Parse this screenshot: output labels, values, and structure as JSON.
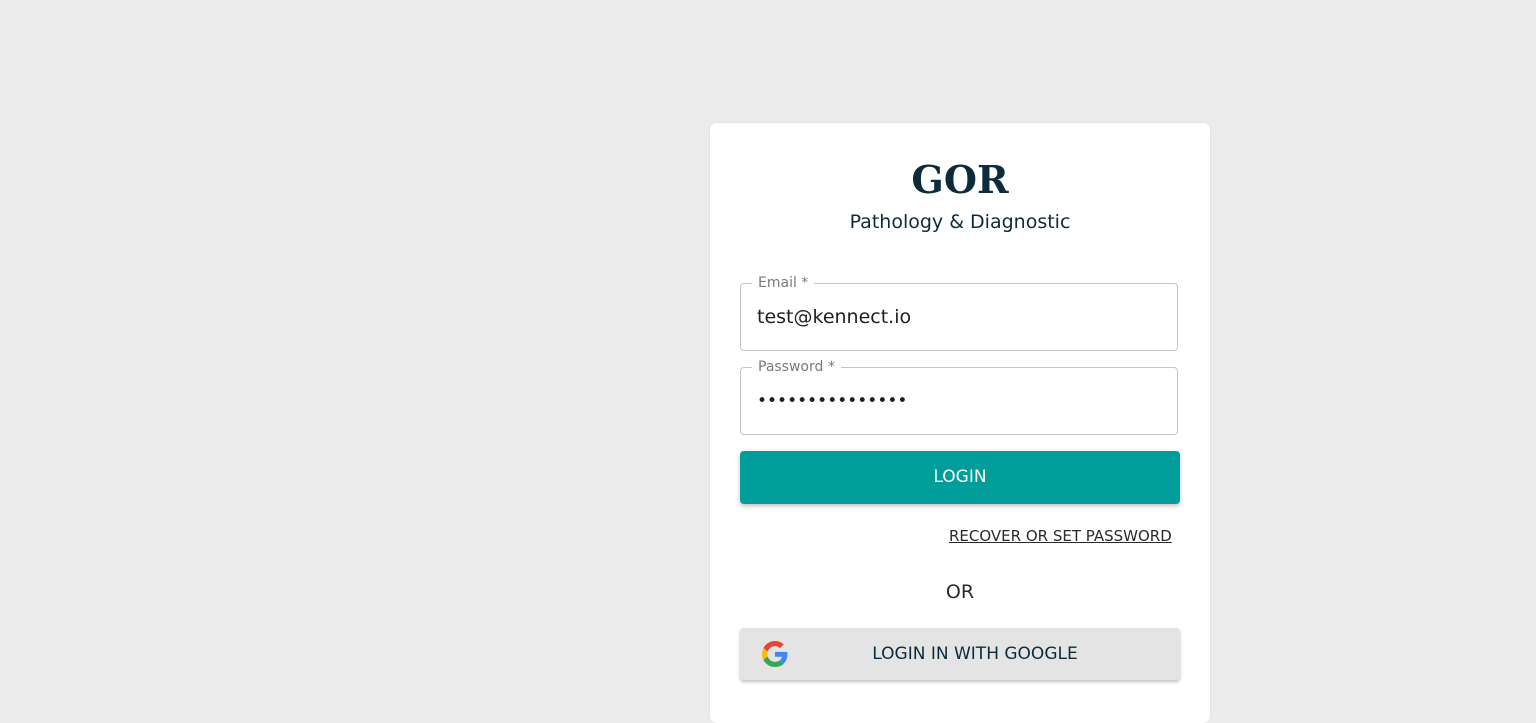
{
  "brand": {
    "title": "GOR",
    "subtitle": "Pathology & Diagnostic"
  },
  "form": {
    "email": {
      "label": "Email *",
      "value": "test@kennect.io"
    },
    "password": {
      "label": "Password *",
      "masked_value": "•••••••••••••••"
    },
    "login_label": "LOGIN",
    "recover_label": "RECOVER OR SET PASSWORD",
    "or_label": "OR",
    "google_label": "LOGIN IN WITH GOOGLE"
  },
  "icons": {
    "google": "google-icon"
  },
  "colors": {
    "background": "#ececec",
    "card": "#ffffff",
    "primary": "#009e9a",
    "brand_text": "#0d2b3a",
    "google_button": "#e4e4e4"
  }
}
